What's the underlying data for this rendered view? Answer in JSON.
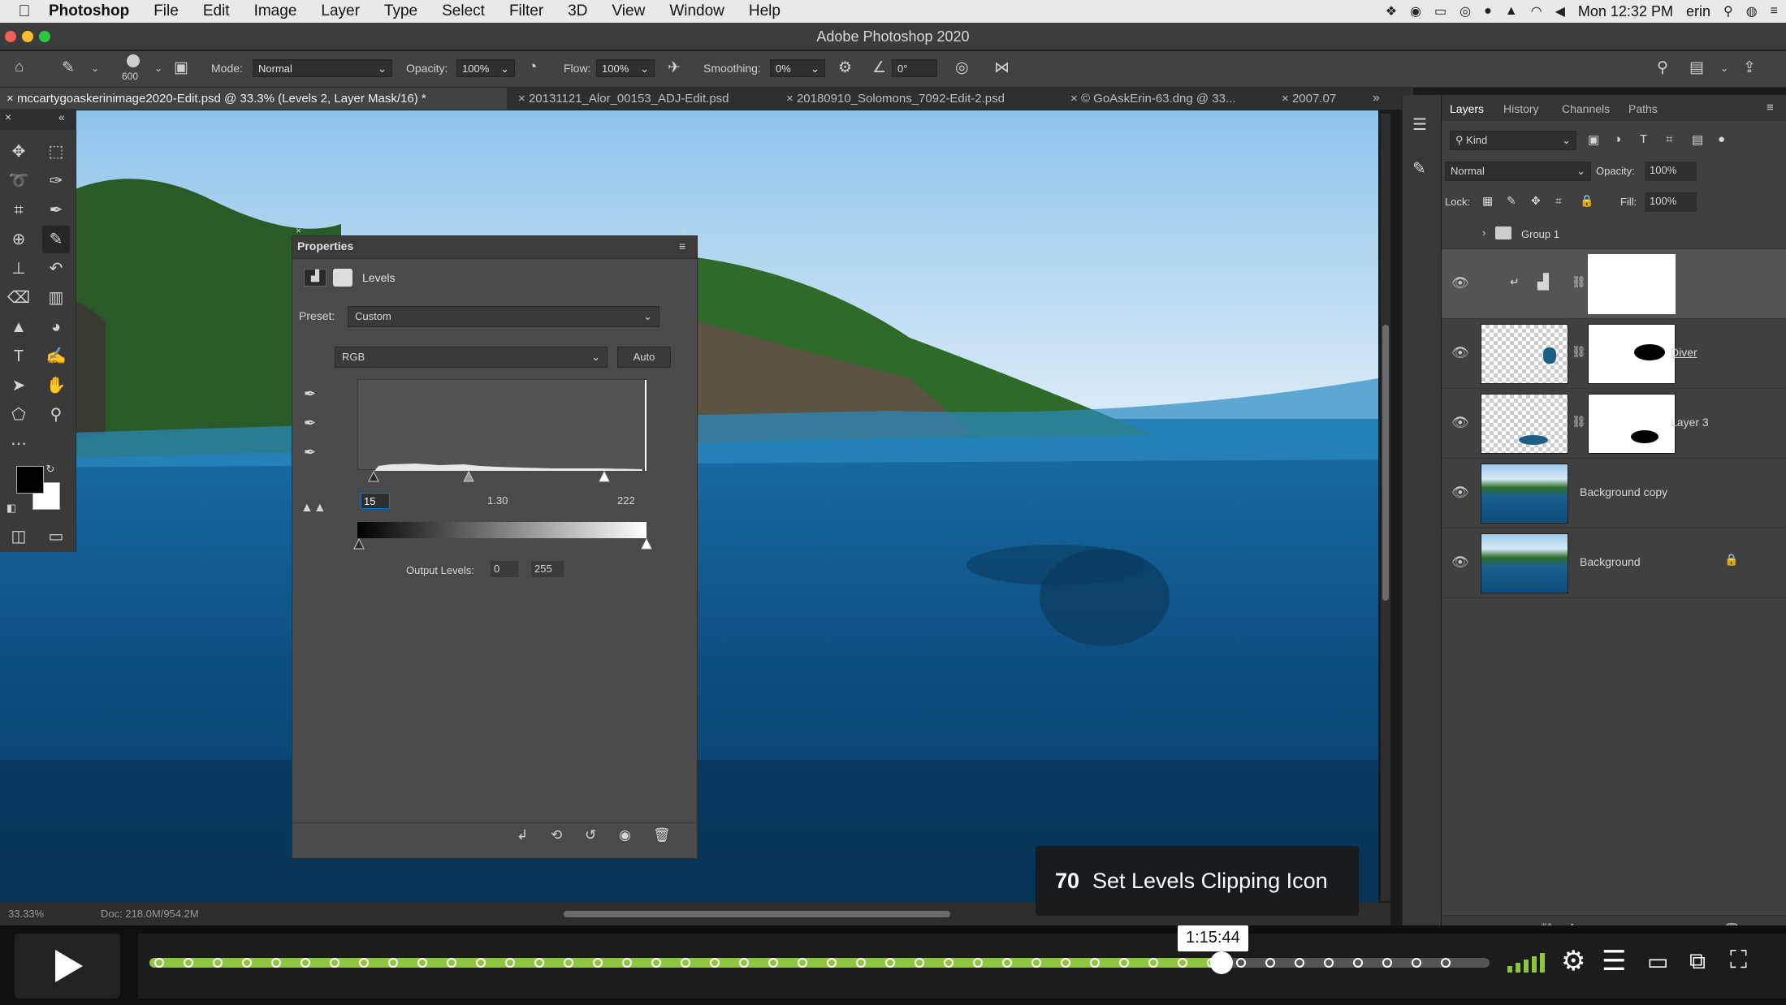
{
  "menubar": {
    "apple": "",
    "app": "Photoshop",
    "items": [
      "File",
      "Edit",
      "Image",
      "Layer",
      "Type",
      "Select",
      "Filter",
      "3D",
      "View",
      "Window",
      "Help"
    ],
    "clock": "Mon 12:32 PM",
    "user": "erin"
  },
  "window": {
    "title": "Adobe Photoshop 2020"
  },
  "options": {
    "brush_size": "600",
    "mode_label": "Mode:",
    "mode_value": "Normal",
    "opacity_label": "Opacity:",
    "opacity_value": "100%",
    "flow_label": "Flow:",
    "flow_value": "100%",
    "smoothing_label": "Smoothing:",
    "smoothing_value": "0%",
    "angle_value": "0°"
  },
  "tabs": [
    {
      "label": "mccartygoaskerinimage2020-Edit.psd @ 33.3% (Levels 2, Layer Mask/16) *"
    },
    {
      "label": "20131121_Alor_00153_ADJ-Edit.psd"
    },
    {
      "label": "20180910_Solomons_7092-Edit-2.psd"
    },
    {
      "label": "© GoAskErin-63.dng @ 33..."
    },
    {
      "label": "2007.07"
    }
  ],
  "properties": {
    "title": "Properties",
    "adjustment": "Levels",
    "preset_label": "Preset:",
    "preset_value": "Custom",
    "channel": "RGB",
    "auto_label": "Auto",
    "input_black": "15",
    "input_gamma": "1.30",
    "input_white": "222",
    "output_label": "Output Levels:",
    "output_black": "0",
    "output_white": "255"
  },
  "layers_panel": {
    "tabs": [
      "Layers",
      "History",
      "Channels",
      "Paths"
    ],
    "kind": "Kind",
    "blend": "Normal",
    "opacity_label": "Opacity:",
    "opacity_value": "100%",
    "lock_label": "Lock:",
    "fill_label": "Fill:",
    "fill_value": "100%",
    "group_name": "Group 1",
    "layers": [
      {
        "name": ""
      },
      {
        "name": "Diver"
      },
      {
        "name": "Layer 3"
      },
      {
        "name": "Background copy"
      },
      {
        "name": "Background"
      }
    ]
  },
  "status": {
    "zoom": "33.33%",
    "doc": "Doc: 218.0M/954.2M"
  },
  "video": {
    "chapter_num": "70",
    "chapter_title": "Set Levels Clipping Icon",
    "timestamp": "1:15:44",
    "played_fraction": 0.8
  }
}
